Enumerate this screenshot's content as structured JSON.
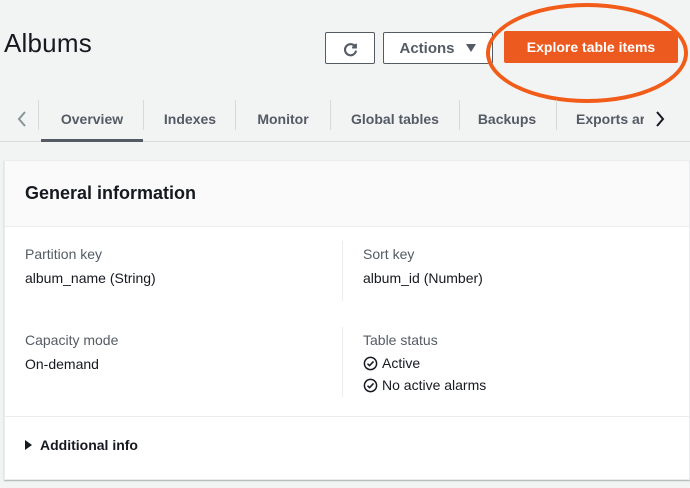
{
  "header": {
    "title": "Albums",
    "actions_label": "Actions",
    "explore_label": "Explore table items"
  },
  "tabs": [
    {
      "label": "Overview",
      "active": true
    },
    {
      "label": "Indexes"
    },
    {
      "label": "Monitor"
    },
    {
      "label": "Global tables"
    },
    {
      "label": "Backups"
    },
    {
      "label": "Exports ar"
    }
  ],
  "general_info": {
    "title": "General information",
    "partition_key_label": "Partition key",
    "partition_key_value": "album_name (String)",
    "sort_key_label": "Sort key",
    "sort_key_value": "album_id (Number)",
    "capacity_mode_label": "Capacity mode",
    "capacity_mode_value": "On-demand",
    "table_status_label": "Table status",
    "status_items": [
      "Active",
      "No active alarms"
    ],
    "additional_info_label": "Additional info"
  },
  "colors": {
    "primary": "#ec5a1f",
    "highlight_ring": "#f25c19"
  },
  "icons": [
    "refresh-icon",
    "caret-down-icon",
    "chevron-left-icon",
    "chevron-right-icon",
    "check-circle-icon",
    "caret-right-icon"
  ]
}
